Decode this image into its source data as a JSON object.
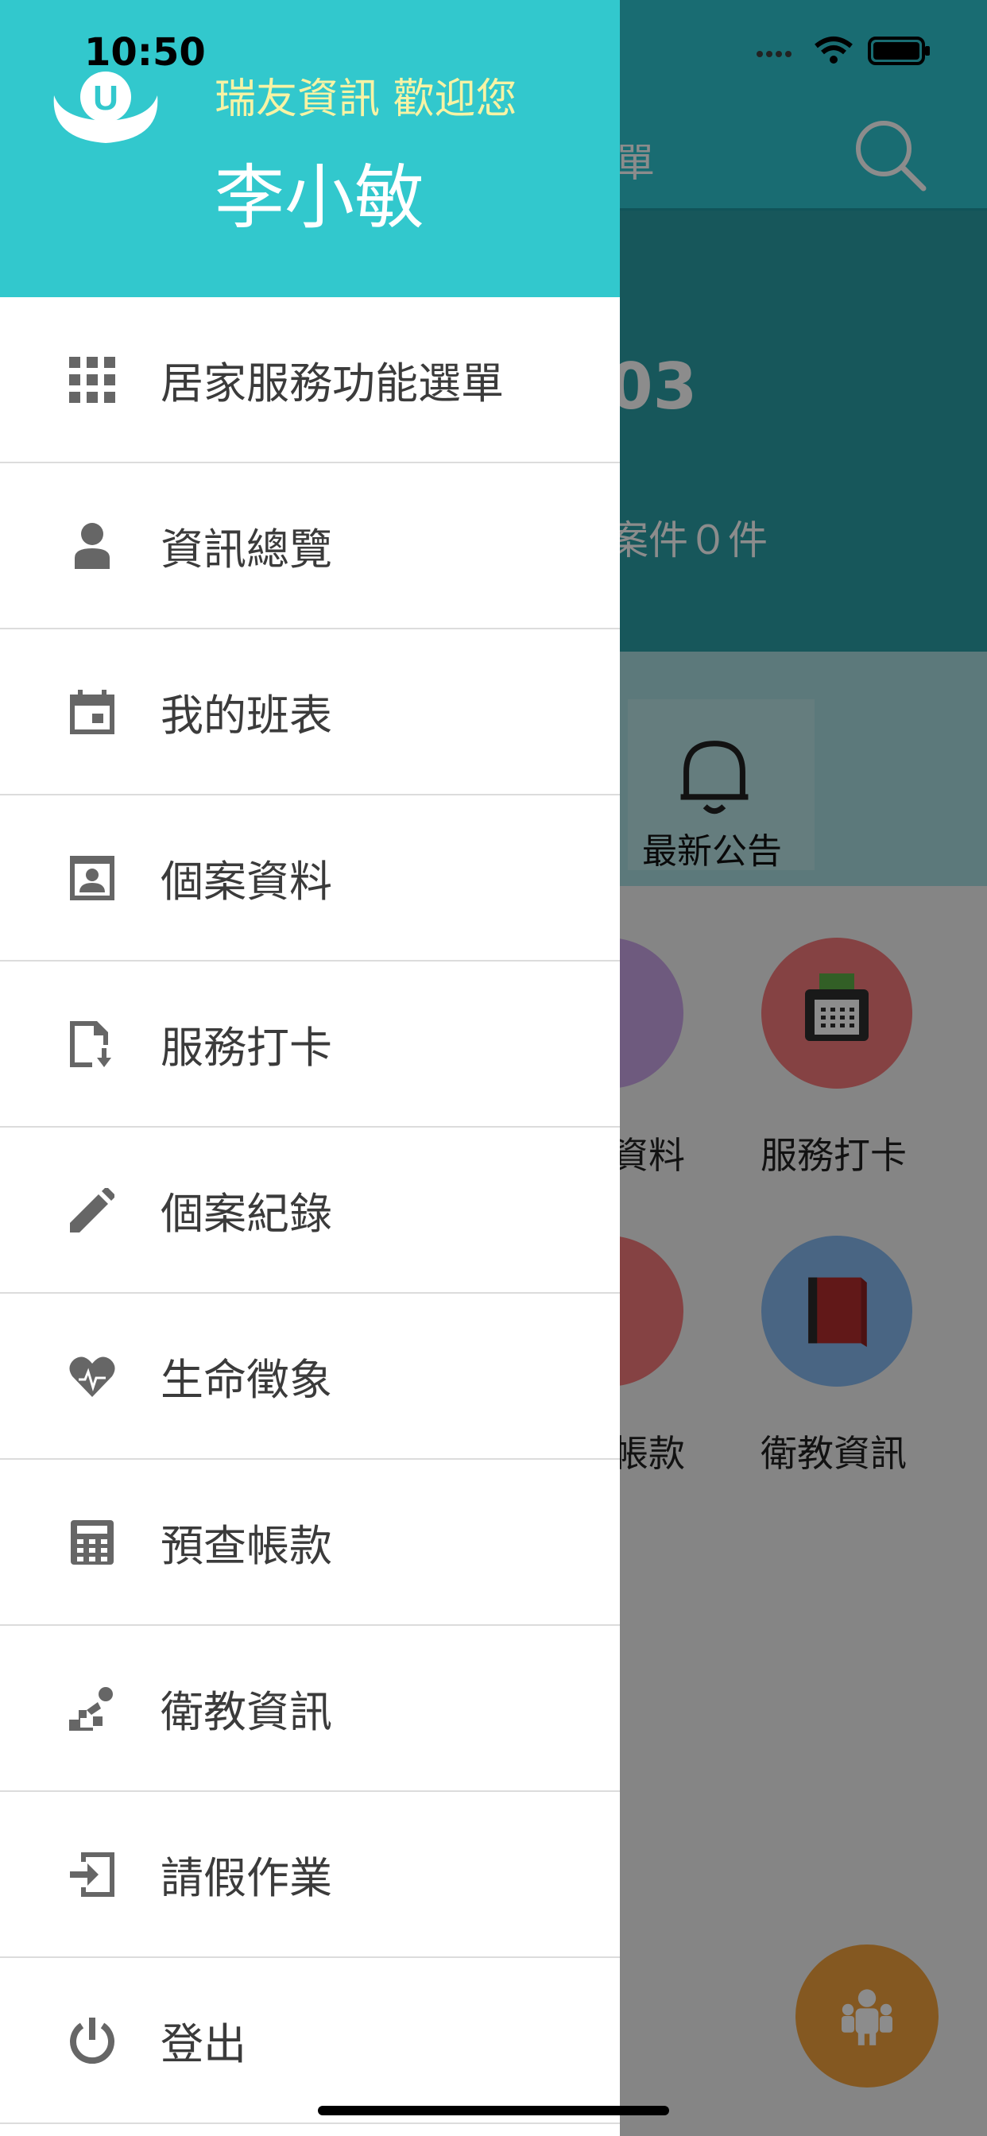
{
  "status_bar": {
    "time": "10:50"
  },
  "background": {
    "tab_text_fragment": "單",
    "banner_number_fragment": "03",
    "banner_cases_fragment": "案件０件",
    "notice_label": "最新公告",
    "grid": [
      {
        "label": "資料",
        "color": "#c9a5e6",
        "icon": "case-data-icon"
      },
      {
        "label": "服務打卡",
        "color": "#f2787a",
        "icon": "fax-icon"
      },
      {
        "label": "帳款",
        "color": "#f2787a",
        "icon": "money-icon"
      },
      {
        "label": "衛教資訊",
        "color": "#86b8ee",
        "icon": "book-icon"
      }
    ],
    "fab_icon": "people-icon"
  },
  "drawer": {
    "welcome": "瑞友資訊 歡迎您",
    "username": "李小敏",
    "menu": [
      {
        "label": "居家服務功能選單",
        "icon": "grid-icon"
      },
      {
        "label": "資訊總覽",
        "icon": "person-icon"
      },
      {
        "label": "我的班表",
        "icon": "calendar-icon"
      },
      {
        "label": "個案資料",
        "icon": "portrait-icon"
      },
      {
        "label": "服務打卡",
        "icon": "clock-in-icon"
      },
      {
        "label": "個案紀錄",
        "icon": "pencil-icon"
      },
      {
        "label": "生命徵象",
        "icon": "heart-pulse-icon"
      },
      {
        "label": "預查帳款",
        "icon": "calculator-icon"
      },
      {
        "label": "衛教資訊",
        "icon": "stairs-person-icon"
      },
      {
        "label": "請假作業",
        "icon": "leave-icon"
      },
      {
        "label": "登出",
        "icon": "logout-icon"
      }
    ]
  },
  "colors": {
    "header_teal": "#32c8cd",
    "welcome_yellow": "#f7f3a4",
    "fab_orange": "#f0a03c"
  }
}
